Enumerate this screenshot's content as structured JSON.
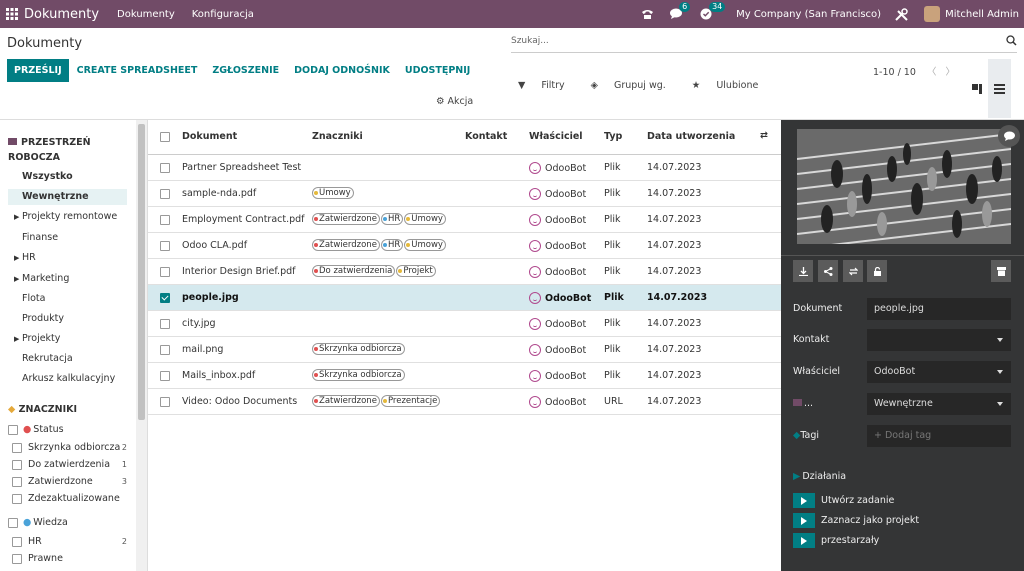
{
  "topbar": {
    "app_title": "Dokumenty",
    "menu": [
      "Dokumenty",
      "Konfiguracja"
    ],
    "chat_badge": "6",
    "activity_badge": "34",
    "company": "My Company (San Francisco)",
    "user": "Mitchell Admin"
  },
  "control": {
    "page_title": "Dokumenty",
    "search_placeholder": "Szukaj...",
    "buttons": {
      "upload": "PRZEŚLIJ",
      "spreadsheet": "CREATE SPREADSHEET",
      "request": "ZGŁOSZENIE",
      "add_link": "DODAJ ODNOŚNIK",
      "share": "UDOSTĘPNIJ"
    },
    "filters": "Filtry",
    "group_by": "Grupuj wg.",
    "favorites": "Ulubione",
    "action": "Akcja",
    "pager": "1-10 / 10"
  },
  "sidebar": {
    "workspace_header": "PRZESTRZEŃ ROBOCZA",
    "workspace_header_line1": "PRZESTRZEŃ",
    "workspace_header_line2": "ROBOCZA",
    "folders": [
      {
        "label": "Wszystko",
        "bold": true
      },
      {
        "label": "Wewnętrzne",
        "active": true
      },
      {
        "label": "Projekty remontowe",
        "caret": true
      },
      {
        "label": "Finanse"
      },
      {
        "label": "HR",
        "caret": true
      },
      {
        "label": "Marketing",
        "caret": true
      },
      {
        "label": "Flota"
      },
      {
        "label": "Produkty"
      },
      {
        "label": "Projekty",
        "caret": true
      },
      {
        "label": "Rekrutacja"
      },
      {
        "label": "Arkusz kalkulacyjny"
      }
    ],
    "tags_header": "ZNACZNIKI",
    "tag_groups": [
      {
        "label": "Status",
        "dot_color": "#e05050",
        "items": [
          {
            "label": "Skrzynka odbiorcza",
            "count": "2"
          },
          {
            "label": "Do zatwierdzenia",
            "count": "1"
          },
          {
            "label": "Zatwierdzone",
            "count": "3"
          },
          {
            "label": "Zdezaktualizowane",
            "count": ""
          }
        ]
      },
      {
        "label": "Wiedza",
        "dot_color": "#4aa3d9",
        "items": [
          {
            "label": "HR",
            "count": "2"
          },
          {
            "label": "Prawne",
            "count": ""
          }
        ]
      }
    ]
  },
  "table": {
    "columns": [
      "Dokument",
      "Znaczniki",
      "Kontakt",
      "Właściciel",
      "Typ",
      "Data utworzenia"
    ],
    "rows": [
      {
        "name": "Partner Spreadsheet Test",
        "tags": [],
        "owner": "OdooBot",
        "type": "Plik",
        "date": "14.07.2023",
        "selected": false
      },
      {
        "name": "sample-nda.pdf",
        "tags": [
          {
            "label": "Umowy",
            "color": "#e5b93b"
          }
        ],
        "owner": "OdooBot",
        "type": "Plik",
        "date": "14.07.2023",
        "selected": false
      },
      {
        "name": "Employment Contract.pdf",
        "tags": [
          {
            "label": "Zatwierdzone",
            "color": "#e05050"
          },
          {
            "label": "HR",
            "color": "#4aa3d9"
          },
          {
            "label": "Umowy",
            "color": "#e5b93b"
          }
        ],
        "owner": "OdooBot",
        "type": "Plik",
        "date": "14.07.2023",
        "selected": false
      },
      {
        "name": "Odoo CLA.pdf",
        "tags": [
          {
            "label": "Zatwierdzone",
            "color": "#e05050"
          },
          {
            "label": "HR",
            "color": "#4aa3d9"
          },
          {
            "label": "Umowy",
            "color": "#e5b93b"
          }
        ],
        "owner": "OdooBot",
        "type": "Plik",
        "date": "14.07.2023",
        "selected": false
      },
      {
        "name": "Interior Design Brief.pdf",
        "tags": [
          {
            "label": "Do zatwierdzenia",
            "color": "#e05050"
          },
          {
            "label": "Projekt",
            "color": "#e5b93b"
          }
        ],
        "owner": "OdooBot",
        "type": "Plik",
        "date": "14.07.2023",
        "selected": false
      },
      {
        "name": "people.jpg",
        "tags": [],
        "owner": "OdooBot",
        "type": "Plik",
        "date": "14.07.2023",
        "selected": true
      },
      {
        "name": "city.jpg",
        "tags": [],
        "owner": "OdooBot",
        "type": "Plik",
        "date": "14.07.2023",
        "selected": false
      },
      {
        "name": "mail.png",
        "tags": [
          {
            "label": "Skrzynka odbiorcza",
            "color": "#e05050"
          }
        ],
        "owner": "OdooBot",
        "type": "Plik",
        "date": "14.07.2023",
        "selected": false
      },
      {
        "name": "Mails_inbox.pdf",
        "tags": [
          {
            "label": "Skrzynka odbiorcza",
            "color": "#e05050"
          }
        ],
        "owner": "OdooBot",
        "type": "Plik",
        "date": "14.07.2023",
        "selected": false
      },
      {
        "name": "Video: Odoo Documents",
        "tags": [
          {
            "label": "Zatwierdzone",
            "color": "#e05050"
          },
          {
            "label": "Prezentacje",
            "color": "#e5b93b"
          }
        ],
        "owner": "OdooBot",
        "type": "URL",
        "date": "14.07.2023",
        "selected": false
      }
    ]
  },
  "panel": {
    "doc_label": "Dokument",
    "doc_value": "people.jpg",
    "contact_label": "Kontakt",
    "contact_value": "",
    "owner_label": "Właściciel",
    "owner_value": "OdooBot",
    "folder_label": "...",
    "folder_value": "Wewnętrzne",
    "tags_label": "Tagi",
    "tags_placeholder": "+ Dodaj tag",
    "actions_header": "Działania",
    "actions": [
      "Utwórz zadanie",
      "Zaznacz jako projekt",
      "przestarzały"
    ]
  }
}
